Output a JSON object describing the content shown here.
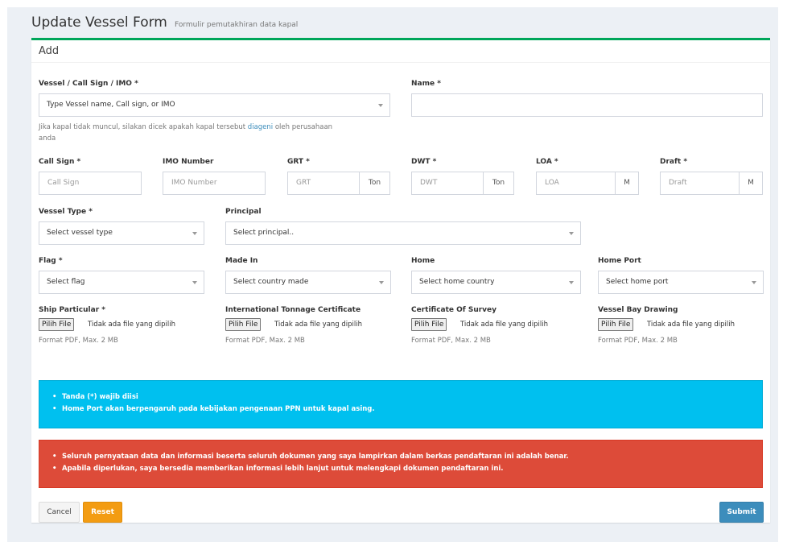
{
  "header": {
    "title": "Update Vessel Form",
    "subtitle": "Formulir pemutakhiran data kapal"
  },
  "box": {
    "title": "Add"
  },
  "form": {
    "vessel": {
      "label": "Vessel / Call Sign / IMO *",
      "placeholder": "Type Vessel name, Call sign, or IMO",
      "help_prefix": "Jika kapal tidak muncul, silakan dicek apakah kapal tersebut ",
      "help_link": "diageni",
      "help_line1_suffix": " oleh perusahaan",
      "help_line2": "anda"
    },
    "name": {
      "label": "Name *",
      "value": ""
    },
    "call_sign": {
      "label": "Call Sign *",
      "placeholder": "Call Sign"
    },
    "imo_number": {
      "label": "IMO Number",
      "placeholder": "IMO Number"
    },
    "grt": {
      "label": "GRT *",
      "placeholder": "GRT",
      "unit": "Ton"
    },
    "dwt": {
      "label": "DWT *",
      "placeholder": "DWT",
      "unit": "Ton"
    },
    "loa": {
      "label": "LOA *",
      "placeholder": "LOA",
      "unit": "M"
    },
    "draft": {
      "label": "Draft *",
      "placeholder": "Draft",
      "unit": "M"
    },
    "vessel_type": {
      "label": "Vessel Type *",
      "selected": "Select vessel type"
    },
    "principal": {
      "label": "Principal",
      "selected": "Select principal.."
    },
    "flag": {
      "label": "Flag *",
      "selected": "Select flag"
    },
    "made_in": {
      "label": "Made In",
      "selected": "Select country made"
    },
    "home": {
      "label": "Home",
      "selected": "Select home country"
    },
    "home_port": {
      "label": "Home Port",
      "selected": "Select home port"
    },
    "files": {
      "button_label": "Pilih File",
      "no_file_text": "Tidak ada file yang dipilih",
      "format_text": "Format PDF, Max. 2 MB",
      "ship_particular": "Ship Particular *",
      "tonnage_certificate": "International Tonnage Certificate",
      "certificate_survey": "Certificate Of Survey",
      "bay_drawing": "Vessel Bay Drawing"
    }
  },
  "notes": {
    "info": [
      "Tanda (*) wajib diisi",
      "Home Port akan berpengaruh pada kebijakan pengenaan PPN untuk kapal asing."
    ],
    "danger": [
      "Seluruh pernyataan data dan informasi beserta seluruh dokumen yang saya lampirkan dalam berkas pendaftaran ini adalah benar.",
      "Apabila diperlukan, saya bersedia memberikan informasi lebih lanjut untuk melengkapi dokumen pendaftaran ini."
    ]
  },
  "buttons": {
    "cancel": "Cancel",
    "reset": "Reset",
    "submit": "Submit"
  },
  "colors": {
    "box_top_border": "#00a65a",
    "info": "#00c0ef",
    "danger": "#dd4b39",
    "reset": "#f39c12",
    "submit": "#3c8dbc",
    "link": "#3c8dbc"
  }
}
